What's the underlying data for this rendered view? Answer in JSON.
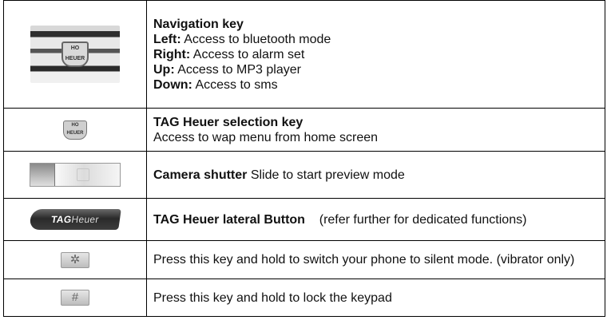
{
  "rows": [
    {
      "icon": "navigation-key-icon",
      "title": "Navigation key",
      "lines": [
        {
          "label": "Left:",
          "text": " Access to bluetooth mode"
        },
        {
          "label": "Right:",
          "text": " Access to alarm set"
        },
        {
          "label": "Up:",
          "text": " Access to MP3 player"
        },
        {
          "label": "Down:",
          "text": " Access to sms"
        }
      ]
    },
    {
      "icon": "tag-heuer-selection-key-icon",
      "title": "TAG Heuer selection key",
      "text": "Access to wap menu from home screen"
    },
    {
      "icon": "camera-shutter-icon",
      "title": "Camera shutter",
      "text": " Slide to start preview mode"
    },
    {
      "icon": "tag-heuer-lateral-button-icon",
      "title": "TAG Heuer lateral Button",
      "text": "    (refer further for dedicated functions)",
      "icon_text_tag": "TAG",
      "icon_text_heuer": "Heuer"
    },
    {
      "icon": "star-key-icon",
      "key_glyph": "✲",
      "text": "Press this key and hold to switch your phone to silent mode. (vibrator only)"
    },
    {
      "icon": "hash-key-icon",
      "key_glyph": "#",
      "text": "Press this key and hold to lock the keypad"
    }
  ]
}
